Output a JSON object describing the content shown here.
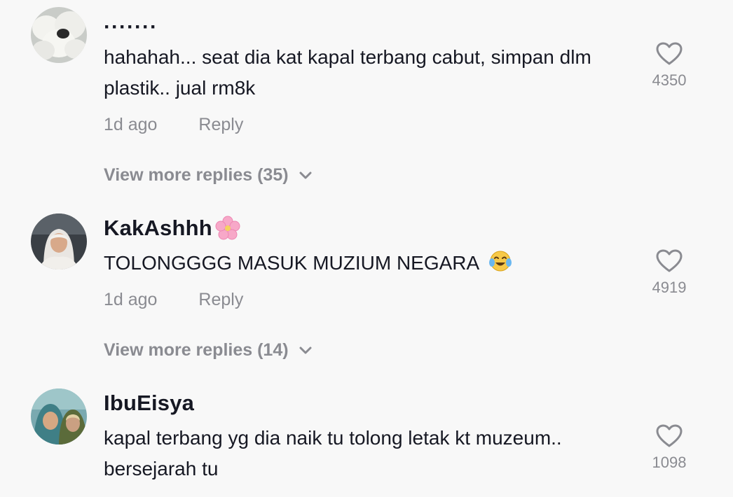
{
  "comments": [
    {
      "username": "·······",
      "text": "hahahah... seat dia kat kapal terbang cabut, simpan dlm plastik.. jual rm8k",
      "time": "1d ago",
      "reply_label": "Reply",
      "likes": "4350",
      "view_more": "View more replies (35)"
    },
    {
      "username": "KakAshhh",
      "username_emoji": "cherry-blossom",
      "text": "TOLONGGGG MASUK MUZIUM NEGARA",
      "text_emoji": "face-with-tears-of-joy",
      "time": "1d ago",
      "reply_label": "Reply",
      "likes": "4919",
      "view_more": "View more replies (14)"
    },
    {
      "username": "IbuEisya",
      "text": "kapal terbang yg dia naik tu tolong letak kt muzeum.. bersejarah tu",
      "likes": "1098"
    }
  ],
  "icons": {
    "like": "heart-outline-icon",
    "expand": "chevron-down-icon"
  },
  "colors": {
    "background": "#f8f8f8",
    "text": "#161823",
    "muted": "#8a8b91"
  }
}
